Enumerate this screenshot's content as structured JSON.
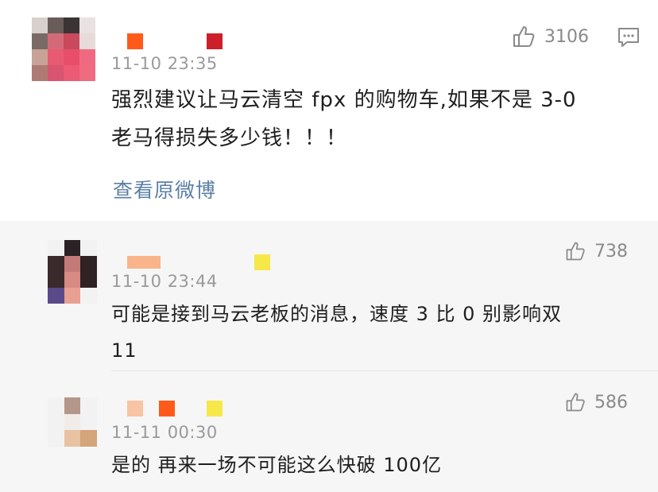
{
  "main_comment": {
    "time": "11-10 23:35",
    "likes": "3106",
    "text_line1": "强烈建议让马云清空 fpx 的购物车,如果不是 3-0",
    "text_line2": "老马得损失多少钱！！！",
    "view_original": "查看原微博",
    "icons": [
      "thumbs-up-icon",
      "comment-icon"
    ]
  },
  "replies": [
    {
      "time": "11-10 23:44",
      "likes": "738",
      "text_line1": "可能是接到马云老板的消息，速度 3 比 0 别影响双",
      "text_line2": "11"
    },
    {
      "time": "11-11 00:30",
      "likes": "586",
      "text_line1": "是的 再来一场不可能这么快破 100亿",
      "text_line2": ""
    }
  ],
  "colors": {
    "link": "#5b7fa6",
    "muted": "#9a9a9a",
    "reply_bg": "#f6f6f6"
  }
}
